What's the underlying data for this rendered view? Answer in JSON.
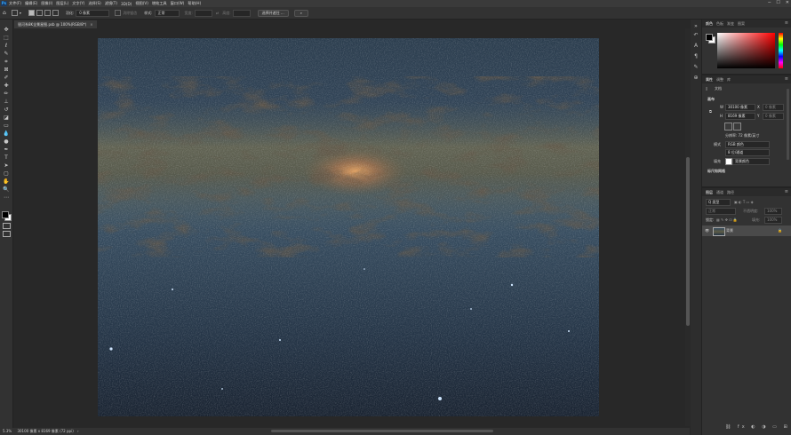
{
  "app": {
    "logo": "Ps"
  },
  "menu": [
    "文件(F)",
    "编辑(E)",
    "图像(I)",
    "图层(L)",
    "文字(Y)",
    "选择(S)",
    "滤镜(T)",
    "3D(D)",
    "视图(V)",
    "增效工具",
    "窗口(W)",
    "帮助(H)"
  ],
  "window_controls": [
    "─",
    "☐",
    "✕"
  ],
  "options": {
    "feather_label": "羽化:",
    "feather_value": "0 像素",
    "antialias": "消除锯齿",
    "style_label": "样式:",
    "style_value": "正常",
    "width_label": "宽度:",
    "height_label": "高度:",
    "select_mask": "选择并遮住 ..."
  },
  "document": {
    "tab_title": "银河系8K全景星图.psb @ 100%(RGB/8*)",
    "close": "×"
  },
  "status": {
    "zoom": "5.3%",
    "size": "30100 像素 x 8169 像素 (72 ppi)",
    "arrow": "›"
  },
  "tools": [
    {
      "name": "move",
      "glyph": "✥"
    },
    {
      "name": "marquee",
      "glyph": "⬚"
    },
    {
      "name": "lasso",
      "glyph": "ℓ"
    },
    {
      "name": "quick-select",
      "glyph": "✎"
    },
    {
      "name": "crop",
      "glyph": "⌗"
    },
    {
      "name": "frame",
      "glyph": "⊠"
    },
    {
      "name": "eyedropper",
      "glyph": "✐"
    },
    {
      "name": "healing",
      "glyph": "✚"
    },
    {
      "name": "brush",
      "glyph": "✏"
    },
    {
      "name": "stamp",
      "glyph": "⊥"
    },
    {
      "name": "history-brush",
      "glyph": "↺"
    },
    {
      "name": "eraser",
      "glyph": "◪"
    },
    {
      "name": "gradient",
      "glyph": "▭"
    },
    {
      "name": "blur",
      "glyph": "💧"
    },
    {
      "name": "dodge",
      "glyph": "●"
    },
    {
      "name": "pen",
      "glyph": "✒"
    },
    {
      "name": "type",
      "glyph": "T"
    },
    {
      "name": "path-select",
      "glyph": "➤"
    },
    {
      "name": "rectangle",
      "glyph": "▢"
    },
    {
      "name": "hand",
      "glyph": "✋"
    },
    {
      "name": "zoom",
      "glyph": "🔍"
    },
    {
      "name": "more",
      "glyph": "⋯"
    }
  ],
  "color_panel": {
    "tabs": [
      "颜色",
      "色板",
      "渐变",
      "图案"
    ],
    "active": "颜色"
  },
  "properties_panel": {
    "tabs": [
      "属性",
      "调整",
      "库"
    ],
    "active": "属性",
    "doc_label": "文档",
    "canvas_section": "画布",
    "w_label": "W",
    "w_value": "30100 像素",
    "x_label": "X",
    "x_value": "0 像素",
    "h_label": "H",
    "h_value": "8169 像素",
    "y_label": "Y",
    "y_value": "0 像素",
    "resolution": "分辨率: 72 像素/英寸",
    "mode_label": "模式",
    "mode_value": "RGB 颜色",
    "depth_value": "8 位/通道",
    "bg_label": "填充",
    "bg_value": "背景颜色",
    "rulers_section": "标尺和网格"
  },
  "layers_panel": {
    "tabs": [
      "图层",
      "通道",
      "路径"
    ],
    "active": "图层",
    "kind_label": "Q 类型",
    "blend_mode": "正常",
    "opacity_label": "不透明度:",
    "opacity_value": "100%",
    "lock_label": "锁定:",
    "fill_label": "填充:",
    "fill_value": "100%",
    "layer_name": "背景"
  },
  "colors": {
    "foreground": "#000000",
    "background": "#ffffff",
    "ps_blue": "#31a8ff"
  }
}
